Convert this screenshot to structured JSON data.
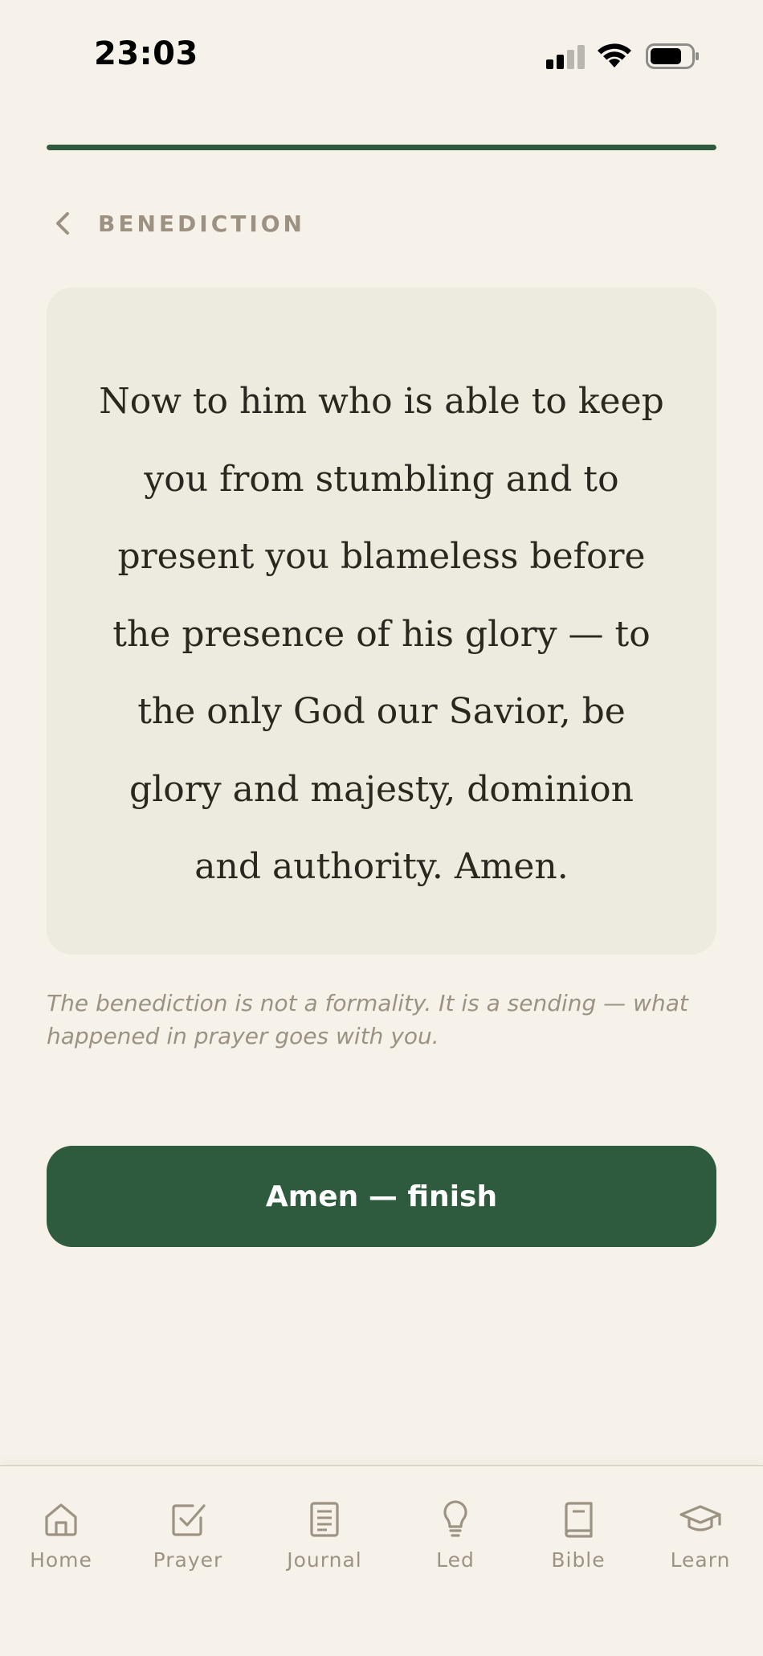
{
  "status_bar": {
    "time": "23:03",
    "signal_icon": "cellular-signal-icon",
    "wifi_icon": "wifi-icon",
    "battery_icon": "battery-icon"
  },
  "progress": {
    "value": 1.0
  },
  "header": {
    "back_icon": "chevron-left-icon",
    "section_title": "BENEDICTION"
  },
  "scripture": {
    "lines": [
      "Now to him who is able to keep",
      "you from stumbling and to",
      "present you blameless before",
      "the presence of his glory — to",
      "the only God our Savior, be",
      "glory and majesty, dominion",
      "and authority. Amen."
    ]
  },
  "note": "The benediction is not a formality. It is a sending — what happened in prayer goes with you.",
  "finish_button": {
    "label": "Amen — finish"
  },
  "tab_bar": {
    "items": [
      {
        "label": "Home",
        "icon": "home-icon"
      },
      {
        "label": "Prayer",
        "icon": "checkbox-icon"
      },
      {
        "label": "Journal",
        "icon": "journal-icon"
      },
      {
        "label": "Led",
        "icon": "lightbulb-icon"
      },
      {
        "label": "Bible",
        "icon": "book-icon"
      },
      {
        "label": "Learn",
        "icon": "graduation-cap-icon"
      }
    ]
  },
  "colors": {
    "background": "#f6f2ea",
    "card": "#edeadf",
    "accent": "#2e5a3e",
    "muted_text": "#9d9383"
  }
}
